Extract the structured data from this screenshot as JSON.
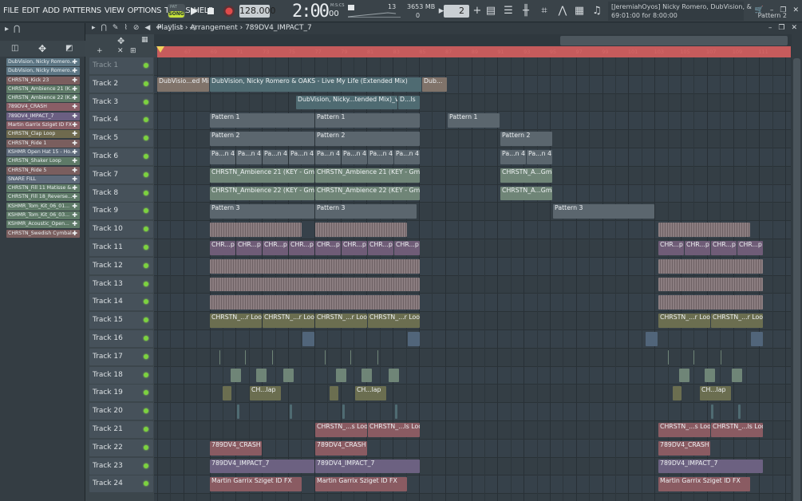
{
  "menu": [
    "FILE",
    "EDIT",
    "ADD",
    "PATTERNS",
    "VIEW",
    "OPTIONS",
    "TOOLS",
    "HELP"
  ],
  "transport": {
    "mode_pattern": "PAT",
    "mode_song": "SONG",
    "tempo": "128.000",
    "time_main": "2:00",
    "time_sub": "00",
    "time_unit": "M:S:CS",
    "cpu": "13",
    "memory": "3653 MB",
    "polyphony": "0",
    "snap": "2"
  },
  "hint": {
    "line1": "[JeremiahOyos] Nicky Romero, DubVision, &",
    "line2": "69:01:00 for 8:00:00",
    "pattern": "Pattern 2"
  },
  "playlist": {
    "title_parts": [
      "Playlist",
      "Arrangement",
      "789DV4_IMPACT_7"
    ],
    "separator": " › "
  },
  "picker": [
    {
      "label": "DubVision, Nicky Romero...",
      "color": "#5d7684"
    },
    {
      "label": "DubVision, Nicky Romero...",
      "color": "#5d7684"
    },
    {
      "label": "CHRSTN_Kick 23",
      "color": "#7a5e5e"
    },
    {
      "label": "CHRSTN_Ambience 21 (K...",
      "color": "#5e7a67"
    },
    {
      "label": "CHRSTN_Ambience 22 (K...",
      "color": "#5e7a67"
    },
    {
      "label": "789DV4_CRASH",
      "color": "#8a5e66"
    },
    {
      "label": "789DV4_IMPACT_7",
      "color": "#6b5f82"
    },
    {
      "label": "Martin Garrix Sziget ID FX",
      "color": "#8a5e66"
    },
    {
      "label": "CHRSTN_Clap Loop",
      "color": "#6f6a4e"
    },
    {
      "label": "CHRSTN_Ride 1",
      "color": "#7a5e5e"
    },
    {
      "label": "KSHMR Open Hat 15 - Ho...",
      "color": "#5e6a7a"
    },
    {
      "label": "CHRSTN_Shaker Loop",
      "color": "#5e7a67"
    },
    {
      "label": "CHRSTN_Ride 5",
      "color": "#7a5e5e"
    },
    {
      "label": "SNARE FILL",
      "color": "#5e6a7a"
    },
    {
      "label": "CHRSTN_Fill 11 Matisse &...",
      "color": "#5e7a67"
    },
    {
      "label": "CHRSTN_Fill 18_Reverse...",
      "color": "#5e7a67"
    },
    {
      "label": "KSHMR_Tom_Kit_06_01...",
      "color": "#5e7a67"
    },
    {
      "label": "KSHMR_Tom_Kit_06_03...",
      "color": "#5e7a67"
    },
    {
      "label": "KSHMR_Acoustic_Open...",
      "color": "#5e7a67"
    },
    {
      "label": "CHRSTN_Swedish Cymbal...",
      "color": "#7a5e5e"
    }
  ],
  "timeline_ticks": [
    "67",
    "69",
    "71",
    "73",
    "75",
    "77",
    "79",
    "81",
    "83",
    "85",
    "87",
    "89",
    "91",
    "93",
    "95",
    "97",
    "99",
    "101",
    "103",
    "105",
    "107",
    "109",
    "111"
  ],
  "tracks": [
    "Track 1",
    "Track 2",
    "Track 3",
    "Track 4",
    "Track 5",
    "Track 6",
    "Track 7",
    "Track 8",
    "Track 9",
    "Track 10",
    "Track 11",
    "Track 12",
    "Track 13",
    "Track 14",
    "Track 15",
    "Track 16",
    "Track 17",
    "Track 18",
    "Track 19",
    "Track 20",
    "Track 21",
    "Track 22",
    "Track 23",
    "Track 24"
  ],
  "clip_labels": {
    "dub_short": "DubVisio...ed Mix)",
    "dub_long": "DubVision, Nicky Romero & OAKS - Live My Life (Extended Mix)",
    "dub_end": "Dub...",
    "vocals": "DubVision, Nicky...tended Mix)_vocals",
    "vocals_end": "D...ls",
    "pattern1": "Pattern 1",
    "pattern2": "Pattern 2",
    "pattern3": "Pattern 3",
    "pa4": "Pa...n 4",
    "amb21": "CHRSTN_Ambience 21 (KEY - Gmaj)",
    "amb21s": "CHRSTN_A...Gmaj)",
    "amb22": "CHRSTN_Ambience 22 (KEY - Gmaj)",
    "amb22s": "CHRSTN_A...Gmaj)",
    "chrp": "CHR...p",
    "chrloop": "CHRSTN_...r Loop",
    "chlap": "CH...lap",
    "chrsloop": "CHRSTN_...s Loop",
    "chrlsloop": "CHRSTN_...ls Loop",
    "crash": "789DV4_CRASH",
    "impact": "789DV4_IMPACT_7",
    "sziget": "Martin Garrix Sziget ID FX"
  }
}
